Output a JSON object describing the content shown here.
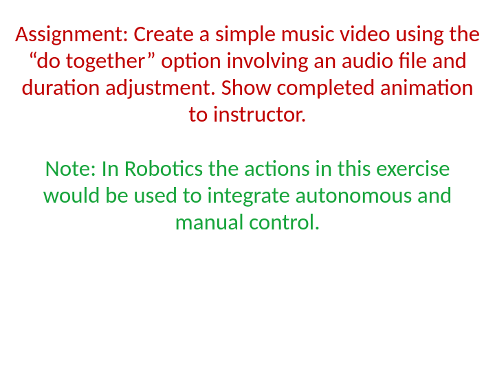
{
  "assignment": "Assignment:  Create a simple music video using the “do together” option involving an audio file and duration adjustment. Show completed animation to instructor.",
  "note": "Note:  In Robotics the actions in this exercise would be used to integrate autonomous and manual control."
}
